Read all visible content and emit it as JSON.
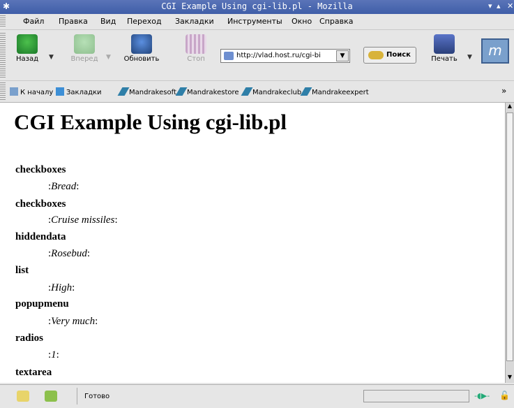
{
  "window": {
    "title": "CGI Example Using cgi-lib.pl - Mozilla"
  },
  "menu": [
    "Файл",
    "Правка",
    "Вид",
    "Переход",
    "Закладки",
    "Инструменты",
    "Окно",
    "Справка"
  ],
  "toolbar": {
    "back": "Назад",
    "forward": "Вперед",
    "reload": "Обновить",
    "stop": "Стоп",
    "url": "http://vlad.host.ru/cgi-bi",
    "search": "Поиск",
    "print": "Печать"
  },
  "personal": {
    "home": "К началу",
    "bookmarks": "Закладки",
    "links": [
      "Mandrakesoft",
      "Mandrakestore",
      "Mandrakeclub",
      "Mandrakeexpert"
    ],
    "more": "»"
  },
  "page": {
    "heading": "CGI Example Using cgi-lib.pl",
    "fields": [
      {
        "name": "checkboxes",
        "value": "Bread"
      },
      {
        "name": "checkboxes",
        "value": "Cruise missiles"
      },
      {
        "name": "hiddendata",
        "value": "Rosebud"
      },
      {
        "name": "list",
        "value": "High"
      },
      {
        "name": "popupmenu",
        "value": "Very much"
      },
      {
        "name": "radios",
        "value": "1"
      },
      {
        "name": "textarea",
        "value": ""
      }
    ],
    "separator": ":"
  },
  "status": {
    "text": "Готово"
  }
}
